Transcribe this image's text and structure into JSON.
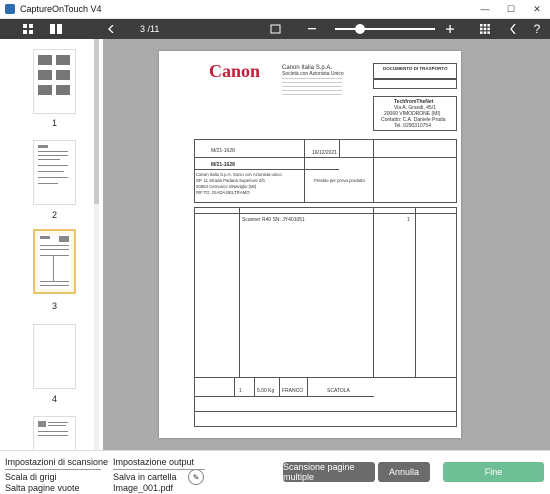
{
  "window": {
    "title": "CaptureOnTouch V4",
    "minimize": "—",
    "maximize": "☐",
    "close": "✕"
  },
  "toolbar": {
    "page_counter": "3 /11",
    "zoom_level": 0.25,
    "icons": [
      "grid-view-icon",
      "two-page-view-icon",
      "previous-page-icon",
      "fit-page-icon",
      "zoom-out-icon",
      "zoom-in-icon",
      "apps-icon",
      "back-icon",
      "help-icon"
    ]
  },
  "thumbnails": [
    {
      "label": "1"
    },
    {
      "label": "2"
    },
    {
      "label": "3",
      "selected": true
    },
    {
      "label": "4"
    },
    {
      "label": ""
    }
  ],
  "document": {
    "logo": "Canon",
    "company_name": "Canon Italia S.p.A.",
    "company_sub": "Società con Azionista Unico",
    "doc_type": "DOCUMENTO DI TRASPORTO",
    "recipient_name": "TechfromTheNet",
    "recipient_addr1": "Via A. Grandi, 45/1",
    "recipient_addr2": "20060 VIMODRONE (MI)",
    "recipient_contact": "Contatto: C.A. Daniele Prada",
    "recipient_tel": "Tel. 0290310754",
    "doc_number_1": "M/21-1628",
    "doc_number_2": "M/21-1628",
    "date": "16/12/2021",
    "sender_1": "Canon Italia S.p.A. Socio con Azionista unico",
    "sender_2": "SP. 11 Strada Padana Superiore 2/b",
    "sender_3": "20063 Cernusco s/Naviglio (MI)",
    "sender_4": "RIF.TO: GIADA BELTRAMO",
    "causale": "Prestito per prova prodotto",
    "item": "Scanner R40   SN: JY401051",
    "qty": "1",
    "weight": "5.00 Kg",
    "porto": "FRANCO",
    "aspetto": "SCATOLA"
  },
  "bottom": {
    "scan_settings_title": "Impostazioni di scansione",
    "scan_mode": "Scala di grigi",
    "skip_blank": "Salta pagine vuote",
    "output_title": "Impostazione output",
    "save_mode": "Salva in cartella",
    "file_name": "Image_001.pdf",
    "multi_scan_label": "Scansione pagine multiple",
    "cancel_label": "Annulla",
    "finish_label": "Fine"
  },
  "colors": {
    "toolbar": "#3d3d3d",
    "viewer_bg": "#ababab",
    "finish": "#6ebf96",
    "secondary_btn": "#6b6b6b"
  }
}
